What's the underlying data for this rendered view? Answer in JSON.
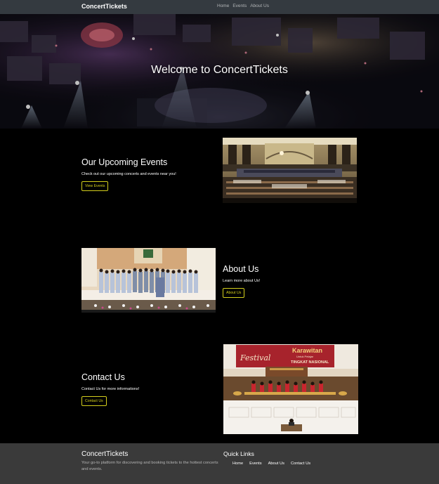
{
  "navbar": {
    "brand": "ConcertTickets",
    "links": [
      "Home",
      "Events",
      "About Us"
    ]
  },
  "hero": {
    "title": "Welcome to ConcertTickets"
  },
  "sections": {
    "events": {
      "heading": "Our Upcoming Events",
      "description": "Check out our upcoming concerts and events near you!",
      "button": "View Events"
    },
    "about": {
      "heading": "About Us",
      "description": "Learn more about Us!",
      "button": "About Us"
    },
    "contact": {
      "heading": "Contact Us",
      "description": "Contact Us for more informations!",
      "button": "Contact Us"
    }
  },
  "banner": {
    "script_text": "Festival",
    "title": "Karawitan",
    "subtitle": "Untuk Pelajar",
    "tagline": "TINGKAT NASIONAL"
  },
  "footer": {
    "brand": "ConcertTickets",
    "description": "Your go-to platform for discovering and booking tickets to the hottest concerts and events.",
    "quick_links_title": "Quick Links",
    "quick_links": [
      "Home",
      "Events",
      "About Us",
      "Contact Us"
    ]
  },
  "colors": {
    "navbar_bg": "#343a40",
    "footer_bg": "#3a3a3a",
    "button_accent": "#d4cf1c",
    "page_bg": "#000000"
  }
}
